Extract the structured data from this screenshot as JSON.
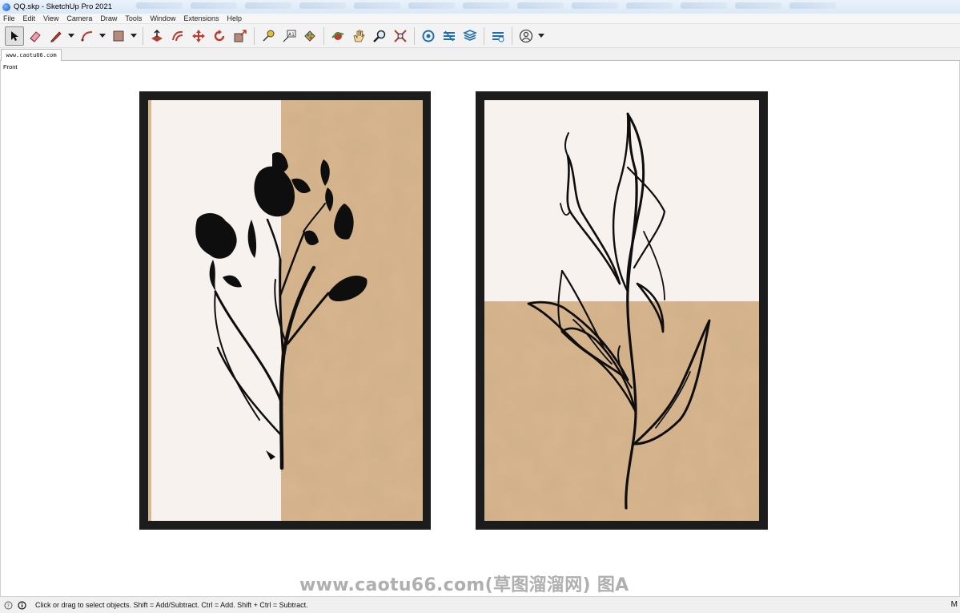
{
  "window": {
    "title": "QQ.skp - SketchUp Pro 2021"
  },
  "menu": [
    "File",
    "Edit",
    "View",
    "Camera",
    "Draw",
    "Tools",
    "Window",
    "Extensions",
    "Help"
  ],
  "toolbar": {
    "tools": [
      {
        "name": "select-tool",
        "icon": "arrow-cursor-icon",
        "active": true
      },
      {
        "name": "eraser-tool",
        "icon": "eraser-icon"
      },
      {
        "name": "line-tool",
        "icon": "pencil-icon",
        "dropdown": true
      },
      {
        "name": "arc-tool",
        "icon": "arc-icon",
        "dropdown": true
      },
      {
        "name": "shape-tool",
        "icon": "rectangle-icon",
        "dropdown": true
      },
      {
        "name": "push-pull-tool",
        "icon": "push-pull-icon"
      },
      {
        "name": "offset-tool",
        "icon": "offset-icon"
      },
      {
        "name": "move-tool",
        "icon": "move-icon"
      },
      {
        "name": "rotate-tool",
        "icon": "rotate-icon"
      },
      {
        "name": "scale-tool",
        "icon": "scale-icon"
      },
      {
        "name": "tape-measure-tool",
        "icon": "tape-measure-icon"
      },
      {
        "name": "text-tool",
        "icon": "text-icon"
      },
      {
        "name": "paint-bucket-tool",
        "icon": "paint-bucket-icon"
      },
      {
        "name": "orbit-tool",
        "icon": "orbit-icon"
      },
      {
        "name": "pan-tool",
        "icon": "pan-hand-icon"
      },
      {
        "name": "zoom-tool",
        "icon": "zoom-icon"
      },
      {
        "name": "zoom-extents-tool",
        "icon": "zoom-extents-icon"
      },
      {
        "name": "3d-warehouse-button",
        "icon": "warehouse-icon"
      },
      {
        "name": "extension-warehouse-button",
        "icon": "extension-warehouse-icon"
      },
      {
        "name": "layout-button",
        "icon": "layout-icon"
      },
      {
        "name": "extension-manager-button",
        "icon": "extension-manager-icon"
      },
      {
        "name": "account-button",
        "icon": "user-account-icon",
        "dropdown": true
      }
    ]
  },
  "scene_tab": {
    "label": "www.caotu66.com"
  },
  "viewport": {
    "view_label": "Front"
  },
  "watermark": {
    "text": "www.caotu66.com(草图溜溜网) 图A"
  },
  "artworks": [
    {
      "name": "flower-print",
      "colors": {
        "frame": "#1c1c1c",
        "light": "#f7f2ee",
        "tan": "#d8b68e"
      }
    },
    {
      "name": "leaf-print",
      "colors": {
        "frame": "#1c1c1c",
        "light": "#f7f2ee",
        "tan": "#d8b68e"
      }
    }
  ],
  "status": {
    "text": "Click or drag to select objects. Shift = Add/Subtract. Ctrl = Add. Shift + Ctrl = Subtract.",
    "right_text": "M"
  }
}
